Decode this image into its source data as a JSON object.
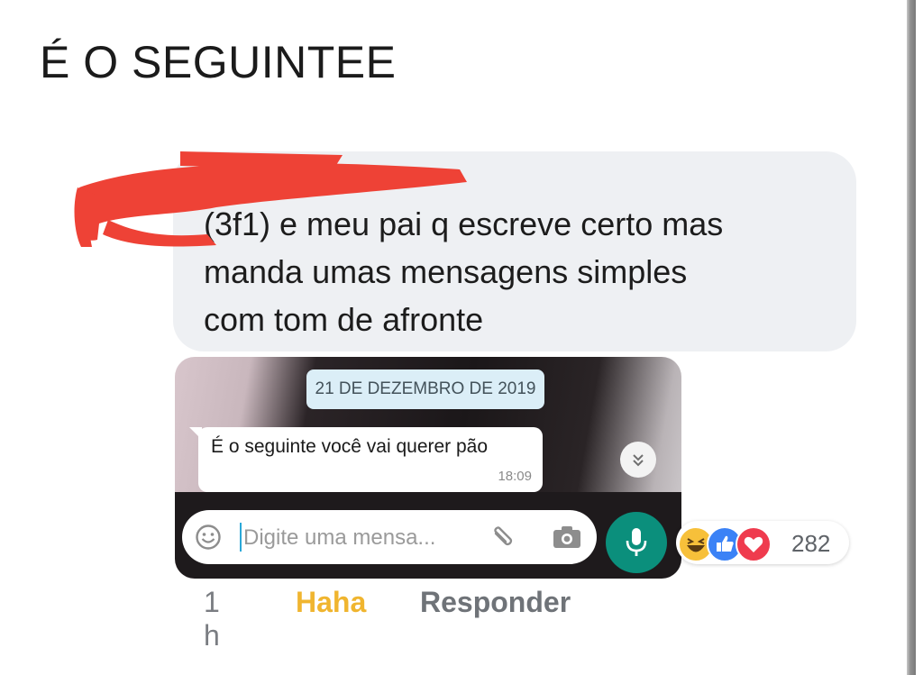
{
  "post": {
    "title": "É O SEGUINTEE"
  },
  "comment": {
    "text_line1": "(3f1) e meu pai q escreve certo mas",
    "text_line2": "manda umas mensagens simples",
    "text_line3": "com tom de afronte"
  },
  "whatsapp": {
    "date_label": "21 DE DEZEMBRO DE 2019",
    "message_text": "É o seguinte você vai querer pão",
    "message_time": "18:09",
    "input_placeholder": "Digite uma mensa...",
    "icons": [
      "emoji-icon",
      "paperclip-icon",
      "camera-icon",
      "microphone-icon",
      "chevron-double-down-icon"
    ],
    "accent": "#0b8f7c"
  },
  "reactions": {
    "types": [
      "haha",
      "like",
      "love"
    ],
    "count": "282"
  },
  "actions": {
    "time": "1 h",
    "reaction_label": "Haha",
    "reply_label": "Responder"
  }
}
